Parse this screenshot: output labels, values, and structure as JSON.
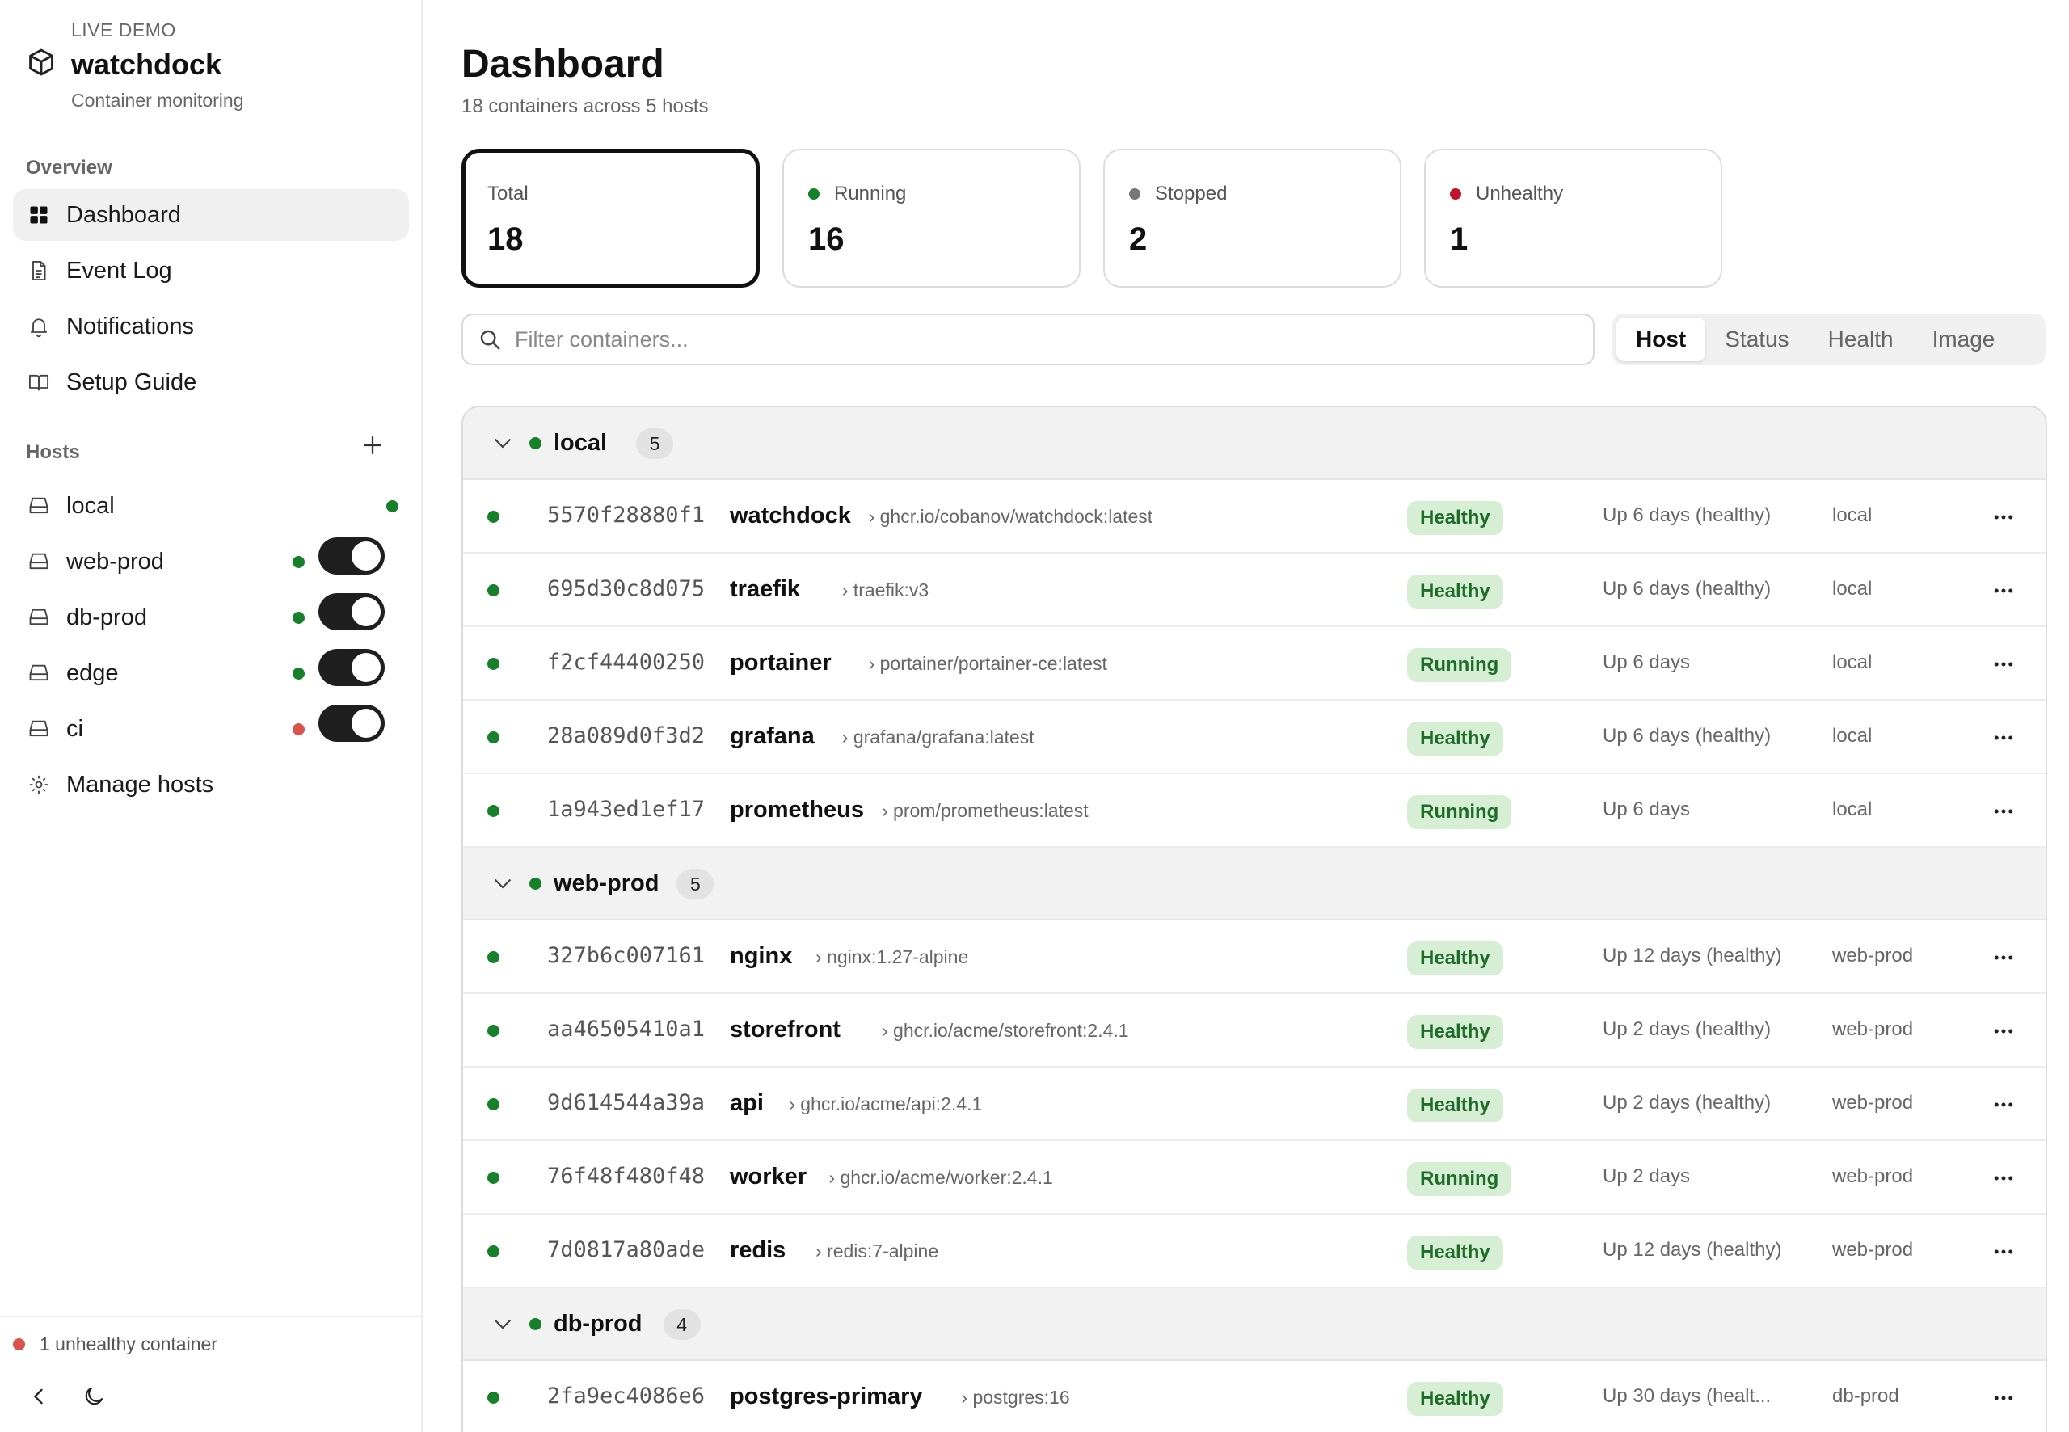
{
  "brand": {
    "tag": "LIVE DEMO",
    "name": "watchdock",
    "subtitle": "Container monitoring"
  },
  "sidebar": {
    "overview_label": "Overview",
    "nav": [
      {
        "label": "Dashboard",
        "icon": "grid-icon",
        "active": true
      },
      {
        "label": "Event Log",
        "icon": "document-icon",
        "active": false
      },
      {
        "label": "Notifications",
        "icon": "bell-icon",
        "active": false
      },
      {
        "label": "Setup Guide",
        "icon": "book-icon",
        "active": false
      }
    ],
    "hosts_label": "Hosts",
    "hosts": [
      {
        "label": "local",
        "status_color": "#16802a",
        "toggle": false
      },
      {
        "label": "web-prod",
        "status_color": "#16802a",
        "toggle": true
      },
      {
        "label": "db-prod",
        "status_color": "#16802a",
        "toggle": true
      },
      {
        "label": "edge",
        "status_color": "#16802a",
        "toggle": true
      },
      {
        "label": "ci",
        "status_color": "#d9534f",
        "toggle": true
      }
    ],
    "manage_label": "Manage hosts",
    "footer_status": "1 unhealthy container"
  },
  "header": {
    "title": "Dashboard",
    "subtitle": "18 containers across 5 hosts"
  },
  "stats": [
    {
      "label": "Total",
      "value": "18",
      "dot": null,
      "active": true
    },
    {
      "label": "Running",
      "value": "16",
      "dot": "#16802a",
      "active": false
    },
    {
      "label": "Stopped",
      "value": "2",
      "dot": "#777777",
      "active": false
    },
    {
      "label": "Unhealthy",
      "value": "1",
      "dot": "#c0142b",
      "active": false
    }
  ],
  "search": {
    "placeholder": "Filter containers..."
  },
  "group_by": {
    "options": [
      "Host",
      "Status",
      "Health",
      "Image"
    ],
    "selected": "Host"
  },
  "groups": [
    {
      "name": "local",
      "count": "5",
      "rows": [
        {
          "id": "5570f28880f1",
          "name": "watchdock",
          "image": "› ghcr.io/cobanov/watchdock:latest",
          "badge": "Healthy",
          "uptime": "Up 6 days (healthy)",
          "host": "local"
        },
        {
          "id": "695d30c8d075",
          "name": "traefik",
          "image": "› traefik:v3",
          "badge": "Healthy",
          "uptime": "Up 6 days (healthy)",
          "host": "local"
        },
        {
          "id": "f2cf44400250",
          "name": "portainer",
          "image": "› portainer/portainer-ce:latest",
          "badge": "Running",
          "uptime": "Up 6 days",
          "host": "local"
        },
        {
          "id": "28a089d0f3d2",
          "name": "grafana",
          "image": "› grafana/grafana:latest",
          "badge": "Healthy",
          "uptime": "Up 6 days (healthy)",
          "host": "local"
        },
        {
          "id": "1a943ed1ef17",
          "name": "prometheus",
          "image": "› prom/prometheus:latest",
          "badge": "Running",
          "uptime": "Up 6 days",
          "host": "local"
        }
      ]
    },
    {
      "name": "web-prod",
      "count": "5",
      "rows": [
        {
          "id": "327b6c007161",
          "name": "nginx",
          "image": "› nginx:1.27-alpine",
          "badge": "Healthy",
          "uptime": "Up 12 days (healthy)",
          "host": "web-prod"
        },
        {
          "id": "aa46505410a1",
          "name": "storefront",
          "image": "› ghcr.io/acme/storefront:2.4.1",
          "badge": "Healthy",
          "uptime": "Up 2 days (healthy)",
          "host": "web-prod"
        },
        {
          "id": "9d614544a39a",
          "name": "api",
          "image": "› ghcr.io/acme/api:2.4.1",
          "badge": "Healthy",
          "uptime": "Up 2 days (healthy)",
          "host": "web-prod"
        },
        {
          "id": "76f48f480f48",
          "name": "worker",
          "image": "› ghcr.io/acme/worker:2.4.1",
          "badge": "Running",
          "uptime": "Up 2 days",
          "host": "web-prod"
        },
        {
          "id": "7d0817a80ade",
          "name": "redis",
          "image": "› redis:7-alpine",
          "badge": "Healthy",
          "uptime": "Up 12 days (healthy)",
          "host": "web-prod"
        }
      ]
    },
    {
      "name": "db-prod",
      "count": "4",
      "rows": [
        {
          "id": "2fa9ec4086e6",
          "name": "postgres-primary",
          "image": "› postgres:16",
          "badge": "Healthy",
          "uptime": "Up 30 days (healt...",
          "host": "db-prod"
        }
      ]
    }
  ],
  "colors": {
    "accent": "#111111",
    "ok": "#16802a",
    "warn": "#d9534f",
    "badge_bg": "#d6efd4",
    "badge_fg": "#1f6b2a"
  }
}
